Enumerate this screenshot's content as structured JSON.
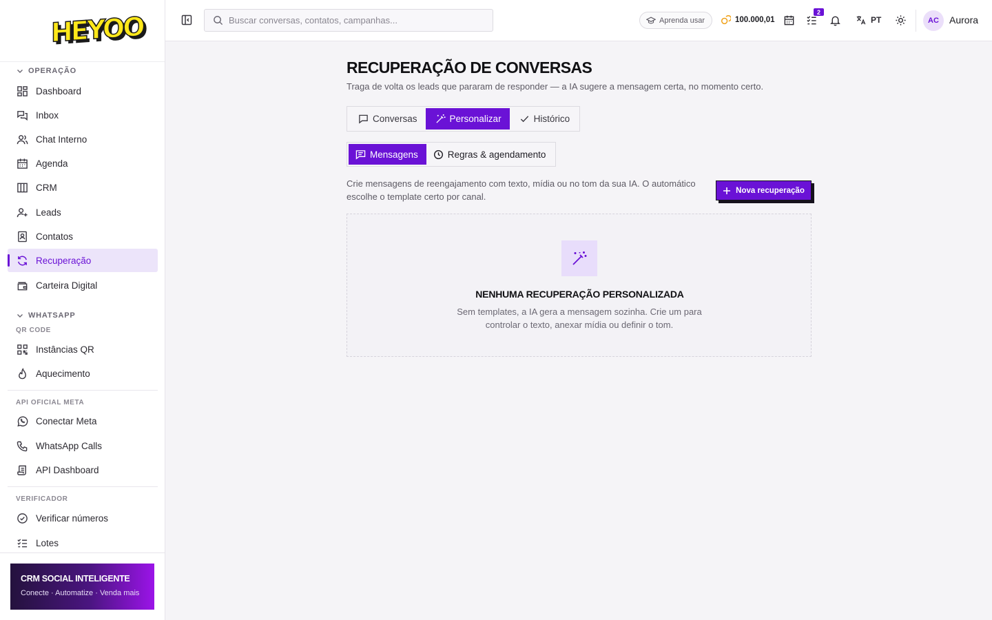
{
  "brand": {
    "logo_text": "HEYOO"
  },
  "sidebar": {
    "sections": {
      "operacao": "OPERAÇÃO",
      "whatsapp": "WHATSAPP",
      "qr_code": "QR CODE",
      "api_meta": "API OFICIAL META",
      "verificador": "VERIFICADOR"
    },
    "items": {
      "dashboard": "Dashboard",
      "inbox": "Inbox",
      "chat_interno": "Chat Interno",
      "agenda": "Agenda",
      "crm": "CRM",
      "leads": "Leads",
      "contatos": "Contatos",
      "recuperacao": "Recuperação",
      "carteira": "Carteira Digital",
      "instancias": "Instâncias QR",
      "aquecimento": "Aquecimento",
      "conectar_meta": "Conectar Meta",
      "calls": "WhatsApp Calls",
      "api_dashboard": "API Dashboard",
      "verificar": "Verificar números",
      "lotes": "Lotes"
    },
    "active_item": "recuperacao",
    "promo": {
      "title": "CRM SOCIAL INTELIGENTE",
      "subtitle": "Conecte · Automatize · Venda mais"
    }
  },
  "topbar": {
    "search_placeholder": "Buscar conversas, contatos, campanhas...",
    "learn_label": "Aprenda usar",
    "credits": "100.000,01",
    "tasks_badge": "2",
    "language": "PT",
    "user_initials": "AC",
    "user_name": "Aurora"
  },
  "page": {
    "title": "RECUPERAÇÃO DE CONVERSAS",
    "subtitle": "Traga de volta os leads que pararam de responder — a IA sugere a mensagem certa, no momento certo.",
    "tabs": [
      "Conversas",
      "Personalizar",
      "Histórico"
    ],
    "active_tab": "Personalizar",
    "subtabs": [
      "Mensagens",
      "Regras & agendamento"
    ],
    "active_subtab": "Mensagens",
    "description": "Crie mensagens de reengajamento com texto, mídia ou no tom da sua IA. O automático escolhe o template certo por canal.",
    "new_button": "Nova recuperação",
    "empty": {
      "title": "NENHUMA RECUPERAÇÃO PERSONALIZADA",
      "text": "Sem templates, a IA gera a mensagem sozinha. Crie um para controlar o texto, anexar mídia ou definir o tom."
    }
  },
  "colors": {
    "accent": "#6a12d6",
    "accent_soft": "#ece4fa",
    "logo_yellow": "#ffe81a"
  }
}
